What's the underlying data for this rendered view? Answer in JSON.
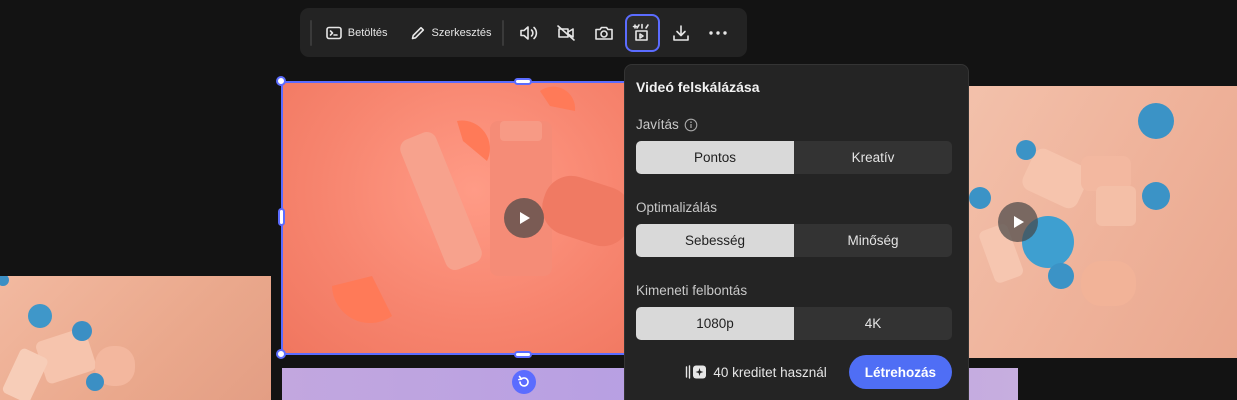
{
  "toolbar": {
    "load_label": "Betöltés",
    "edit_label": "Szerkesztés",
    "icons": [
      "terminal-icon",
      "pencil-icon",
      "volume-icon",
      "video-off-icon",
      "camera-icon",
      "upscale-icon",
      "download-icon",
      "more-icon"
    ]
  },
  "panel": {
    "title": "Videó felskálázása",
    "enhance": {
      "label": "Javítás",
      "options": [
        "Pontos",
        "Kreatív"
      ],
      "selected": "Pontos"
    },
    "optimize": {
      "label": "Optimalizálás",
      "options": [
        "Sebesség",
        "Minőség"
      ],
      "selected": "Sebesség"
    },
    "resolution": {
      "label": "Kimeneti felbontás",
      "options": [
        "1080p",
        "4K"
      ],
      "selected": "1080p"
    },
    "credits_label": "40 kreditet használ",
    "create_label": "Létrehozás"
  },
  "colors": {
    "accent": "#5b6cff",
    "button": "#4f6ef5",
    "panel_bg": "#242424",
    "toolbar_bg": "#232323"
  }
}
